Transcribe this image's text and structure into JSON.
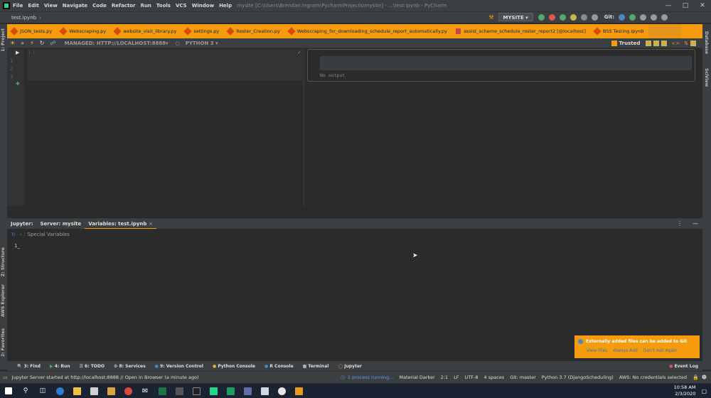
{
  "window": {
    "menu": [
      "File",
      "Edit",
      "View",
      "Navigate",
      "Code",
      "Refactor",
      "Run",
      "Tools",
      "VCS",
      "Window",
      "Help"
    ],
    "title_path": "mysite [C:\\Users\\Brendan.Ingram\\PycharmProjects\\mysite] - ...\\test.ipynb - PyCharm"
  },
  "navbar": {
    "file": "test.ipynb",
    "run_config": "MYSITE",
    "git_label": "Git:"
  },
  "tabs": [
    {
      "label": "JSON_tests.py",
      "icon": "python-file-icon"
    },
    {
      "label": "Webscraping.py",
      "icon": "python-file-icon"
    },
    {
      "label": "website_visit_library.py",
      "icon": "python-file-icon"
    },
    {
      "label": "settings.py",
      "icon": "python-file-icon"
    },
    {
      "label": "Roster_Creation.py",
      "icon": "python-file-icon"
    },
    {
      "label": "Webscraping_for_downloading_schedule_report_automatically.py",
      "icon": "python-file-icon"
    },
    {
      "label": "assist_scheme_schedule_roster_report2 [@localhost]",
      "icon": "database-file-icon"
    },
    {
      "label": "BSS Testing.ipynb",
      "icon": "notebook-file-icon"
    }
  ],
  "notebook": {
    "kernel_url": "MANAGED: HTTP://LOCALHOST:8888",
    "python": "PYTHON 3",
    "trusted": "Trusted",
    "cell_prompt": "[ ]:",
    "line_numbers": [
      "1",
      "2",
      "3"
    ],
    "output_text": "No output"
  },
  "tool_window": {
    "title": "Jupyter:",
    "tabs": [
      "Server: mysite",
      "Variables: test.ipynb"
    ],
    "tree_item": "Special Variables",
    "prompt": "1_"
  },
  "left_stripe": [
    "1: Project",
    "Z: Structure",
    "AWS Explorer",
    "2: Favorites"
  ],
  "right_stripe": [
    "Database",
    "SciView"
  ],
  "tool_strip": [
    {
      "num": "3",
      "label": "Find"
    },
    {
      "num": "4",
      "label": "Run"
    },
    {
      "num": "6",
      "label": "TODO"
    },
    {
      "num": "8",
      "label": "Services"
    },
    {
      "num": "9",
      "label": "Version Control"
    },
    {
      "num": "",
      "label": "Python Console"
    },
    {
      "num": "",
      "label": "R Console"
    },
    {
      "num": "",
      "label": "Terminal"
    },
    {
      "num": "",
      "label": "Jupyter"
    }
  ],
  "event_log": "Event Log",
  "status": {
    "message": "Jupyter Server started at http://localhost:8888 // Open in Browser (a minute ago)",
    "process": "1 process running...",
    "theme": "Material Darker",
    "position": "2:1",
    "line_sep": "LF",
    "encoding": "UTF-8",
    "indent": "4 spaces",
    "branch": "Git: master",
    "interpreter": "Python 3.7 (DjangoScheduling)",
    "aws": "AWS: No credentials selected"
  },
  "notification": {
    "title": "Externally added files can be added to Git",
    "actions": [
      "View Files",
      "Always Add",
      "Don't Ask Again"
    ]
  },
  "taskbar": {
    "time": "10:58 AM",
    "date": "2/3/2020"
  },
  "colors": {
    "accent": "#f49c0d",
    "background": "#2b2b2b",
    "panel": "#3c3f41"
  }
}
